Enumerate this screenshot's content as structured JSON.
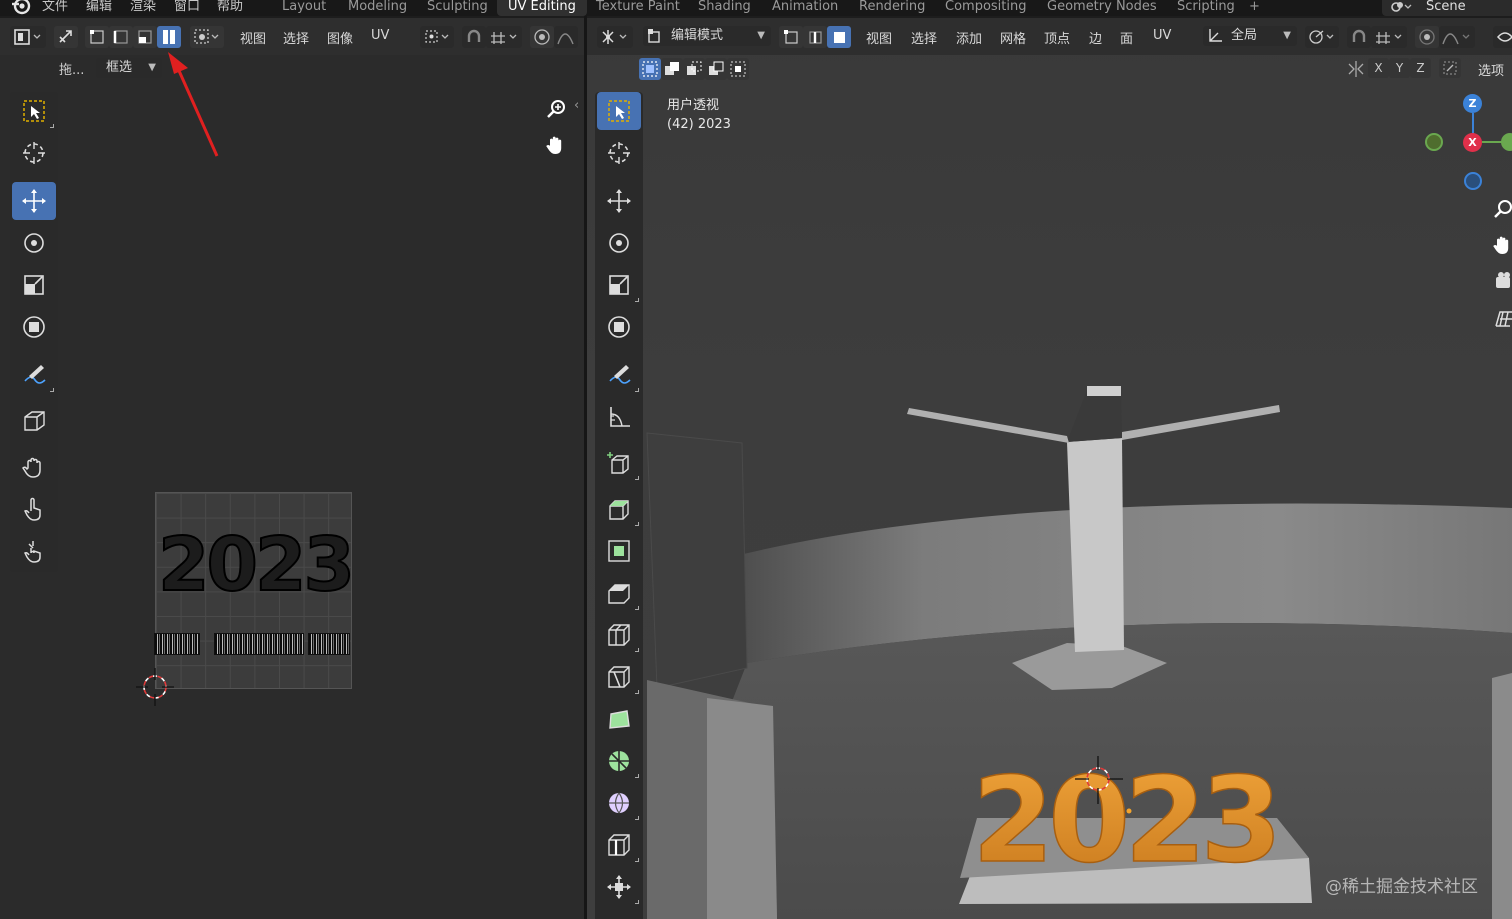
{
  "topbar": {
    "menu": [
      "文件",
      "编辑",
      "渲染",
      "窗口",
      "帮助"
    ],
    "workspaces": [
      "Layout",
      "Modeling",
      "Sculpting",
      "UV Editing",
      "Texture Paint",
      "Shading",
      "Animation",
      "Rendering",
      "Compositing",
      "Geometry Nodes",
      "Scripting"
    ],
    "active_workspace": "UV Editing",
    "add_tab": "+",
    "scene_name": "Scene"
  },
  "uv_editor": {
    "menus": [
      "视图",
      "选择",
      "图像",
      "UV"
    ],
    "drag_label": "拖...",
    "select_mode": "框选",
    "active_sync_mode": "island",
    "tools": [
      "select-box",
      "cursor",
      "move",
      "rotate",
      "scale",
      "transform",
      "annotate",
      "rip",
      "grab",
      "relax",
      "pinch"
    ],
    "active_tool": "move",
    "image_text": "2023",
    "annotation_arrow_color": "#e02020"
  },
  "viewport": {
    "mode": "编辑模式",
    "menus": [
      "视图",
      "选择",
      "添加",
      "网格",
      "顶点",
      "边",
      "面",
      "UV"
    ],
    "transform_orientation": "全局",
    "options_label": "选项",
    "axis_buttons": [
      "X",
      "Y",
      "Z"
    ],
    "view_name": "用户透视",
    "object_info": "(42) 2023",
    "tools": [
      "select-box",
      "cursor",
      "move",
      "rotate",
      "scale",
      "transform",
      "annotate",
      "measure",
      "add-cube",
      "extrude",
      "inset",
      "bevel",
      "loop-cut",
      "knife",
      "poly-build",
      "spin",
      "smooth",
      "edge-slide",
      "shrink-fatten",
      "shear"
    ],
    "active_tool": "select-box",
    "gizmo": {
      "x": "X",
      "z": "Z",
      "x_color": "#e0304a",
      "y_color": "#6aa84f",
      "z_color": "#3b82d8"
    },
    "text_object": "2023",
    "text_color": "#e39a2e",
    "watermark": "@稀土掘金技术社区"
  }
}
